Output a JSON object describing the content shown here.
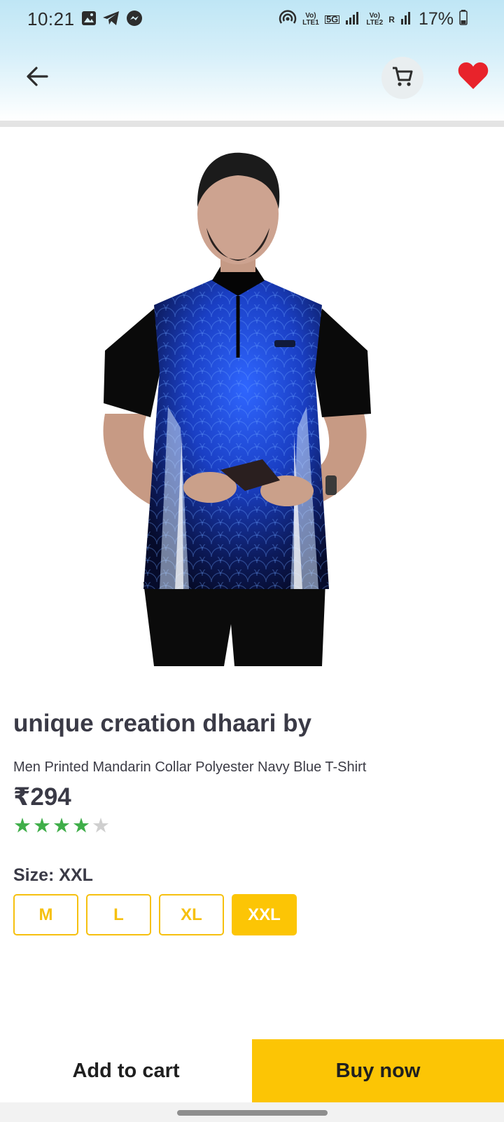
{
  "status_bar": {
    "time": "10:21",
    "battery": "17%",
    "sim1_label": "Vo) LTE1",
    "sim2_label": "Vo) LTE2",
    "network_5g": "5G",
    "roaming": "R"
  },
  "nav": {
    "back_icon": "arrow-left-icon",
    "cart_icon": "shopping-cart-icon",
    "wishlist_icon": "heart-icon",
    "wishlist_color": "#e8232b"
  },
  "product": {
    "image_alt": "Man wearing blue and black printed mandarin collar t-shirt",
    "brand": "unique creation dhaari by",
    "description": "Men Printed Mandarin Collar Polyester Navy Blue T-Shirt",
    "price": "₹294",
    "rating": 4,
    "rating_max": 5
  },
  "size": {
    "label": "Size: XXL",
    "options": [
      "M",
      "L",
      "XL",
      "XXL"
    ],
    "selected": "XXL"
  },
  "actions": {
    "add_to_cart": "Add to cart",
    "buy_now": "Buy now"
  },
  "colors": {
    "accent": "#fcc505",
    "rating_star": "#3fae49",
    "header_gradient_top": "#bfe6f5"
  }
}
